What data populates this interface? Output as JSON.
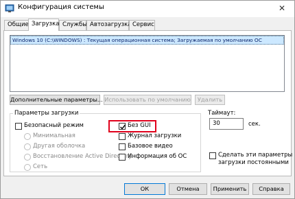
{
  "window": {
    "title": "Конфигурация системы",
    "close_glyph": "✕"
  },
  "tabs": [
    {
      "label": "Общие",
      "active": false
    },
    {
      "label": "Загрузка",
      "active": true
    },
    {
      "label": "Службы",
      "active": false
    },
    {
      "label": "Автозагрузка",
      "active": false
    },
    {
      "label": "Сервис",
      "active": false
    }
  ],
  "os_list": {
    "entries": [
      "Windows 10 (C:\\WINDOWS) : Текущая операционная система; Загружаемая по умолчанию ОС"
    ]
  },
  "buttons": {
    "advanced": "Дополнительные параметры...",
    "set_default": "Использовать по умолчанию",
    "delete": "Удалить"
  },
  "boot_options": {
    "group_label": "Параметры загрузки",
    "safe_boot": {
      "label": "Безопасный режим",
      "checked": false
    },
    "radios": [
      {
        "label": "Минимальная"
      },
      {
        "label": "Другая оболочка"
      },
      {
        "label": "Восстановление Active Directory"
      },
      {
        "label": "Сеть"
      }
    ],
    "no_gui": {
      "label": "Без GUI",
      "checked": true
    },
    "boot_log": {
      "label": "Журнал загрузки",
      "checked": false
    },
    "base_video": {
      "label": "Базовое видео",
      "checked": false
    },
    "os_info": {
      "label": "Информация об ОС",
      "checked": false
    }
  },
  "timeout": {
    "label": "Таймаут:",
    "value": "30",
    "unit": "сек."
  },
  "permanent": {
    "label_line1": "Сделать эти параметры",
    "label_line2": "загрузки постоянными",
    "checked": false
  },
  "footer": {
    "ok": "ОК",
    "cancel": "Отмена",
    "apply": "Применить",
    "help": "Справка"
  },
  "colors": {
    "accent": "#0078d7",
    "selection": "#cce8ff",
    "highlight_box": "#e0001b"
  }
}
